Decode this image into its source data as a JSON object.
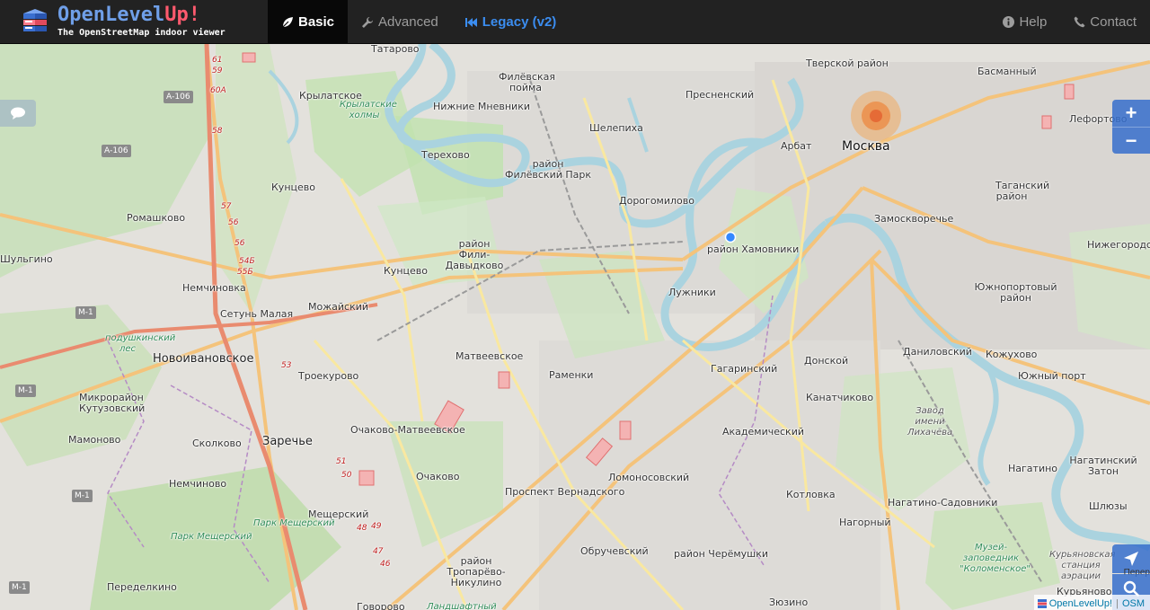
{
  "brand": {
    "title_part1": "OpenLevel",
    "title_part2": "Up!",
    "subtitle": "The OpenStreetMap indoor viewer"
  },
  "nav": {
    "basic": "Basic",
    "advanced": "Advanced",
    "legacy": "Legacy (v2)",
    "help": "Help",
    "contact": "Contact"
  },
  "map_controls": {
    "zoom_in": "+",
    "zoom_out": "−"
  },
  "attribution": {
    "olu": "OpenLevelUp!",
    "sep": "|",
    "osm": "OSM"
  },
  "colors": {
    "navbar_bg": "#222222",
    "active_tab_bg": "#080808",
    "legacy_link": "#3b8df0",
    "control_blue": "#366ecd"
  },
  "map_labels": {
    "tatarovo": "Татарово",
    "krylatskoe": "Крылатское",
    "krylatskie_holmy": "Крылатские холмы",
    "filevskaya_poyma": "Филёвская пойма",
    "nizhnie_mnevniki": "Нижние Мневники",
    "presnensky": "Пресненский",
    "tverskoy": "Тверской район",
    "basmanny": "Басманный",
    "lefortovo": "Лефортово",
    "sheleпiha": "Шелепиха",
    "arbat": "Арбат",
    "moskva": "Москва",
    "terekhovo": "Терехово",
    "filevsky_park": "район Филёвский Парк",
    "kuntsevo1": "Кунцево",
    "dorogomilovo": "Дорогомилово",
    "tagansky": "Таганский район",
    "romashkovo": "Ромашково",
    "zamoskvorechye": "Замоскворечье",
    "khamovniki": "район Хамовники",
    "fili_davydkovo": "район Фили-Давыдково",
    "nizhegorodsky": "Нижегородский",
    "shulgino": "Шульгино",
    "kuntsevo2": "Кунцево",
    "nemchinovka": "Немчиновка",
    "luzhniki": "Лужники",
    "yuzhnoportovy": "Южнопортовый район",
    "setun_malaya": "Сетунь Малая",
    "mozhaysky": "Можайский",
    "podushkinsky": "подушкинский лес",
    "novoivanovskoe": "Новоивановское",
    "matveevskoe": "Матвеевское",
    "danilovsky": "Даниловский",
    "kozhukhovo": "Кожухово",
    "troekurovo": "Троекурово",
    "donskoy": "Донской",
    "gagarinsky": "Гагаринский",
    "yuzhny_port": "Южный порт",
    "ramenki": "Раменки",
    "mikroraion": "Микрорайон Кутузовский",
    "kanatchikovo": "Канатчиково",
    "zavod": "Завод имени Лихачёва",
    "mamonovo": "Мамоново",
    "ochakovo_matveevskoe": "Очаково-Матвеевское",
    "akademichesky": "Академический",
    "skolkovo": "Сколково",
    "zarechye": "Заречье",
    "nagatino": "Нагатино",
    "nagatinsky_zaton": "Нагатинский Затон",
    "lomonosovsky": "Ломоносовский",
    "ochakovo": "Очаково",
    "nemchinovo": "Немчиново",
    "prospekt_vernadskogo": "Проспект Вернадского",
    "kotlovka": "Котловка",
    "nagatino_sadovniki": "Нагатино-Садовники",
    "shlyuzy": "Шлюзы",
    "park_meshchersky1": "Парк Мещерский",
    "meshchersky": "Мещерский",
    "nagorny": "Нагорный",
    "park_meshchersky2": "Парк Мещерский",
    "obruchevsky": "Обручевский",
    "cheremushki": "район Черёмушки",
    "muzey": "Музей-заповедник \"Коломенское\"",
    "kuryanovskaya": "Курьяновская станция аэрации",
    "troparevo": "район Тропарёво-Никулино",
    "peredelkino": "Переделкино",
    "govorovo": "Говорово",
    "landshaftny": "Ландшафтный",
    "zyuzino": "Зюзино",
    "kuryanovo": "Курьяново",
    "perer": "Перер",
    "a106a": "А-106",
    "a106b": "А-106",
    "m1a": "М-1",
    "m1b": "М-1",
    "m1c": "М-1",
    "m1d": "М-1",
    "r61": "61",
    "r59": "59",
    "r60a": "60А",
    "r58": "58",
    "r57": "57",
    "r56a": "56",
    "r56b": "56",
    "r54b": "54Б",
    "r55b": "55Б",
    "r53": "53",
    "r51": "51",
    "r50": "50",
    "r48": "48",
    "r49": "49",
    "r47": "47",
    "r46": "46"
  }
}
